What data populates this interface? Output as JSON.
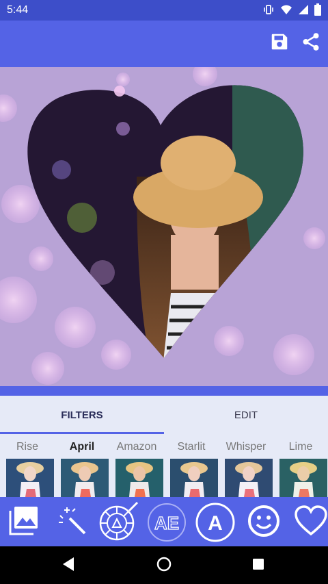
{
  "status_bar": {
    "time": "5:44",
    "icons": [
      "vibrate-icon",
      "wifi-icon",
      "signal-icon",
      "battery-icon"
    ]
  },
  "app_bar": {
    "actions": [
      "save-icon",
      "share-icon"
    ]
  },
  "colors": {
    "accent": "#5463e6",
    "status": "#3d4ec9",
    "panel": "#e6eaf7",
    "canvas": "#b8a3d6"
  },
  "tabs": [
    {
      "label": "FILTERS",
      "active": true
    },
    {
      "label": "EDIT",
      "active": false
    }
  ],
  "filters": [
    {
      "label": "Rise"
    },
    {
      "label": "April",
      "selected": true
    },
    {
      "label": "Amazon"
    },
    {
      "label": "Starlit"
    },
    {
      "label": "Whisper"
    },
    {
      "label": "Lime"
    }
  ],
  "toolbar": {
    "tools": [
      "gallery-icon",
      "magic-wand-icon",
      "color-wheel-icon",
      "text-art-icon",
      "text-icon",
      "emoji-icon",
      "heart-icon"
    ],
    "text_art_label": "AE",
    "text_label": "A"
  },
  "nav_bar": {
    "buttons": [
      "back-icon",
      "home-icon",
      "recents-icon"
    ]
  }
}
